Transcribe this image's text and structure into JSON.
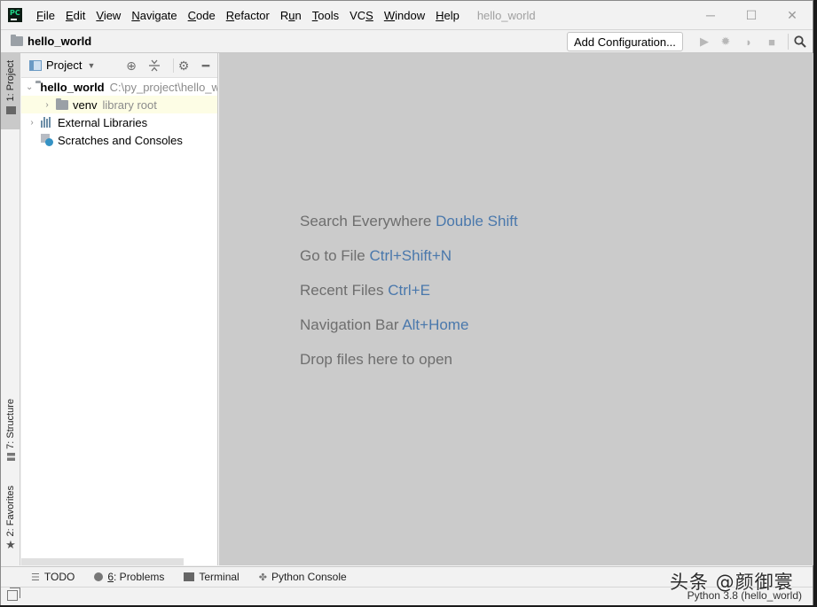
{
  "app": {
    "logo_text": "PC",
    "window_title": "hello_world"
  },
  "menu": [
    {
      "label": "File",
      "mnemonic": "F"
    },
    {
      "label": "Edit",
      "mnemonic": "E"
    },
    {
      "label": "View",
      "mnemonic": "V"
    },
    {
      "label": "Navigate",
      "mnemonic": "N"
    },
    {
      "label": "Code",
      "mnemonic": "C"
    },
    {
      "label": "Refactor",
      "mnemonic": "R"
    },
    {
      "label": "Run",
      "mnemonic": "u"
    },
    {
      "label": "Tools",
      "mnemonic": "T"
    },
    {
      "label": "VCS",
      "mnemonic": "S"
    },
    {
      "label": "Window",
      "mnemonic": "W"
    },
    {
      "label": "Help",
      "mnemonic": "H"
    }
  ],
  "window_controls": {
    "minimize": "─",
    "maximize": "☐",
    "close": "✕"
  },
  "navbar": {
    "project_name": "hello_world",
    "add_configuration_label": "Add Configuration...",
    "icons": [
      "run-icon",
      "debug-icon",
      "coverage-icon",
      "stop-icon",
      "search-icon"
    ]
  },
  "left_strip": {
    "tabs": [
      {
        "label": "1: Project",
        "icon": "folder-icon",
        "active": true
      },
      {
        "label": "7: Structure",
        "icon": "structure-icon",
        "active": false
      },
      {
        "label": "2: Favorites",
        "icon": "star-icon",
        "active": false
      }
    ]
  },
  "project_panel": {
    "title": "Project",
    "tree": [
      {
        "name": "hello_world",
        "detail": "C:\\py_project\\hello_world",
        "expanded": true,
        "type": "folder"
      },
      {
        "name": "venv",
        "detail": "library root",
        "expanded": false,
        "type": "folder"
      },
      {
        "name": "External Libraries",
        "expanded": false,
        "type": "libraries"
      },
      {
        "name": "Scratches and Consoles",
        "type": "scratches"
      }
    ]
  },
  "editor": {
    "hints": [
      {
        "text": "Search Everywhere",
        "shortcut": "Double Shift"
      },
      {
        "text": "Go to File",
        "shortcut": "Ctrl+Shift+N"
      },
      {
        "text": "Recent Files",
        "shortcut": "Ctrl+E"
      },
      {
        "text": "Navigation Bar",
        "shortcut": "Alt+Home"
      },
      {
        "text": "Drop files here to open",
        "shortcut": ""
      }
    ]
  },
  "bottom_tools": [
    {
      "label": "TODO",
      "icon": "list-icon"
    },
    {
      "prefix": "6",
      "label": ": Problems",
      "icon": "problems-icon"
    },
    {
      "label": "Terminal",
      "icon": "terminal-icon"
    },
    {
      "label": "Python Console",
      "icon": "python-icon"
    }
  ],
  "statusbar": {
    "interpreter": "Python 3.8 (hello_world)",
    "watermark": "头条 @颜御寰"
  }
}
